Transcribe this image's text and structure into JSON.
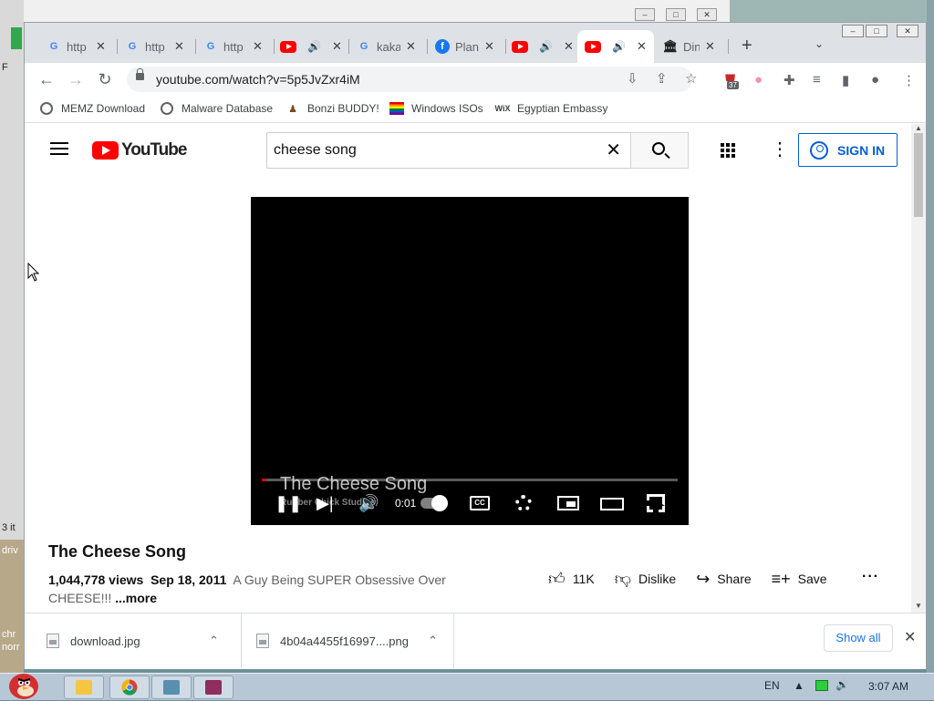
{
  "desktop": {
    "side_labels": [
      "F",
      "3 it",
      "driv",
      "chr",
      "norr"
    ]
  },
  "tabs": [
    {
      "icon": "google-icon",
      "title": "http",
      "audio": false,
      "active": false
    },
    {
      "icon": "google-icon",
      "title": "http",
      "audio": false,
      "active": false
    },
    {
      "icon": "google-icon",
      "title": "http",
      "audio": false,
      "active": false
    },
    {
      "icon": "youtube-icon",
      "title": "",
      "audio": true,
      "active": false
    },
    {
      "icon": "google-icon",
      "title": "kaka",
      "audio": false,
      "active": false
    },
    {
      "icon": "facebook-icon",
      "title": "Plan",
      "audio": false,
      "active": false
    },
    {
      "icon": "youtube-icon",
      "title": "",
      "audio": true,
      "active": false
    },
    {
      "icon": "youtube-icon",
      "title": "",
      "audio": true,
      "active": true
    },
    {
      "icon": "bank-icon",
      "title": "Din",
      "audio": false,
      "active": false
    }
  ],
  "toolbar": {
    "url": "youtube.com/watch?v=5p5JvZxr4iM",
    "extension_badge": "37"
  },
  "bookmarks": [
    {
      "label": "MEMZ Download",
      "icon": "globe-icon"
    },
    {
      "label": "Malware Database",
      "icon": "globe-icon"
    },
    {
      "label": "Bonzi BUDDY!",
      "icon": "bonzi-icon"
    },
    {
      "label": "Windows ISOs",
      "icon": "rainbow-flag-icon"
    },
    {
      "label": "Egyptian Embassy",
      "icon": "wix-icon"
    }
  ],
  "youtube": {
    "logo_text": "YouTube",
    "search_value": "cheese song",
    "sign_in": "SIGN IN",
    "player": {
      "overlay_title": "The Cheese Song",
      "overlay_channel": "Rubber Chick Studios",
      "time": "0:01",
      "progress": 0.01,
      "cc_label": "CC"
    },
    "video_title": "The Cheese Song",
    "views": "1,044,778 views",
    "date": "Sep 18, 2011",
    "description": "A Guy Being SUPER Obsessive Over CHEESE!!!",
    "more": "...more",
    "likes": "11K",
    "dislike": "Dislike",
    "share": "Share",
    "save": "Save"
  },
  "downloads": [
    {
      "name": "download.jpg"
    },
    {
      "name": "4b04a4455f16997....png"
    }
  ],
  "downloads_show_all": "Show all",
  "taskbar": {
    "lang": "EN",
    "clock": "3:07 AM"
  }
}
